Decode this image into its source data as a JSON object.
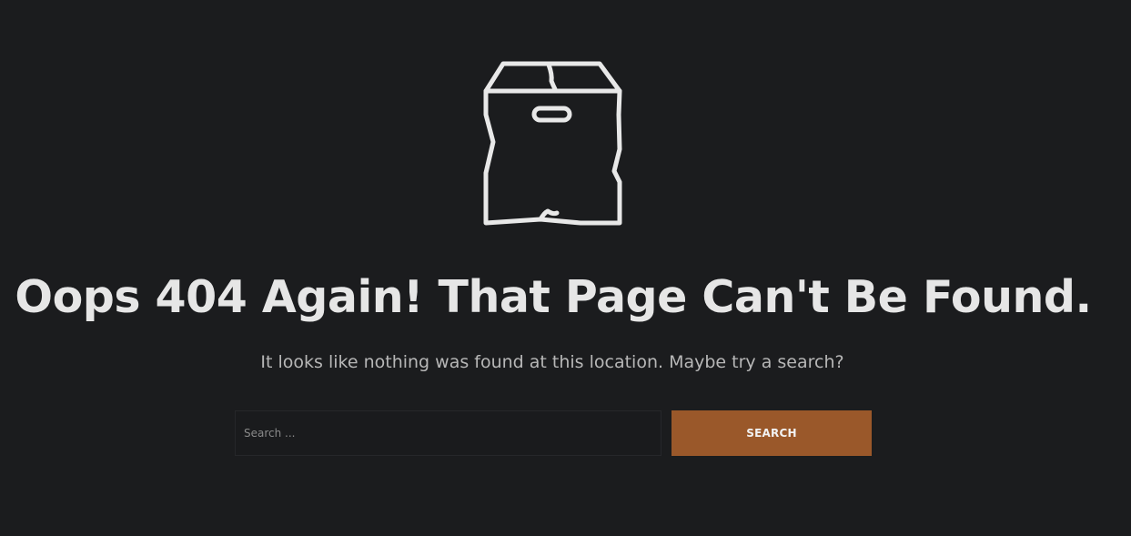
{
  "icon": {
    "name": "box-icon",
    "color": "#e8e8e8"
  },
  "heading": "Oops 404 Again! That Page Can't Be Found.",
  "message": "It looks like nothing was found at this location. Maybe try a search?",
  "search": {
    "placeholder": "Search ...",
    "value": "",
    "button_label": "SEARCH"
  },
  "colors": {
    "background": "#1b1c1e",
    "heading": "#e6e6e6",
    "message": "#b7b7b7",
    "button": "#9a582a"
  }
}
